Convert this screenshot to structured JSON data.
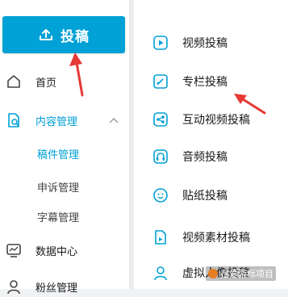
{
  "sidebar": {
    "upload_button": "投稿",
    "items": [
      {
        "label": "首页",
        "icon": "home-icon"
      },
      {
        "label": "内容管理",
        "icon": "content-manage-icon"
      },
      {
        "label": "数据中心",
        "icon": "data-center-icon"
      },
      {
        "label": "粉丝管理",
        "icon": "fans-icon"
      }
    ],
    "sub_items": [
      "稿件管理",
      "申诉管理",
      "字幕管理"
    ]
  },
  "menu": {
    "items": [
      {
        "label": "视频投稿",
        "icon": "video-upload-icon"
      },
      {
        "label": "专栏投稿",
        "icon": "article-upload-icon"
      },
      {
        "label": "互动视频投稿",
        "icon": "interactive-video-icon"
      },
      {
        "label": "音频投稿",
        "icon": "audio-upload-icon"
      },
      {
        "label": "贴纸投稿",
        "icon": "sticker-upload-icon"
      },
      {
        "label": "视频素材投稿",
        "icon": "video-material-icon"
      },
      {
        "label": "虚拟人像投稿",
        "icon": "virtual-avatar-icon"
      }
    ]
  },
  "watermark": {
    "text": "在爱游标项目"
  },
  "colors": {
    "accent": "#00a1d6",
    "annotation_arrow": "#e53935"
  }
}
